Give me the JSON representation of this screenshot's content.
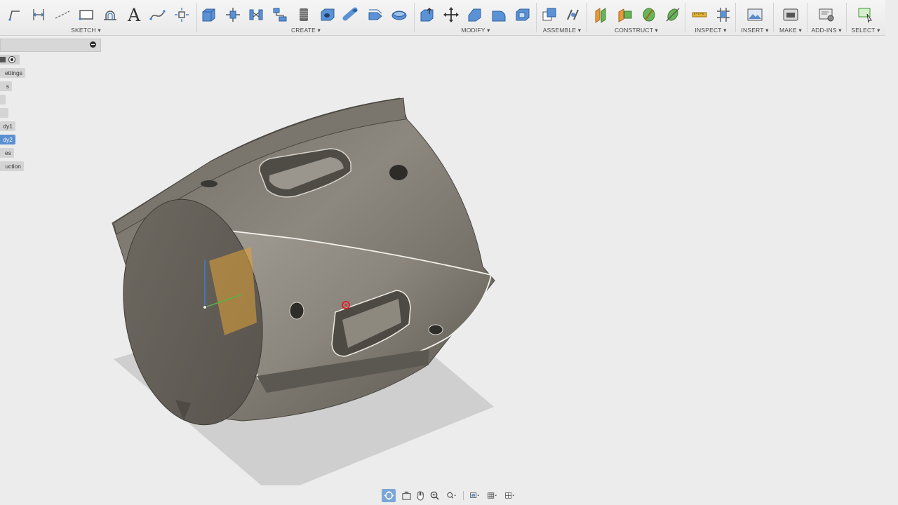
{
  "toolbar": {
    "groups": {
      "sketch": "SKETCH ▾",
      "create": "CREATE ▾",
      "modify": "MODIFY ▾",
      "assemble": "ASSEMBLE ▾",
      "construct": "CONSTRUCT ▾",
      "inspect": "INSPECT ▾",
      "insert": "INSERT ▾",
      "make": "MAKE ▾",
      "addins": "ADD-INS ▾",
      "select": "SELECT ▾"
    },
    "text_tool_glyph": "A"
  },
  "browser": {
    "nodes": [
      "ettings",
      "s",
      "",
      "",
      "dy1",
      "dy2",
      "es",
      "uction"
    ]
  },
  "colors": {
    "accent": "#3d7fd0",
    "selection": "#5a8fd0",
    "body_metal": "#807c73"
  }
}
